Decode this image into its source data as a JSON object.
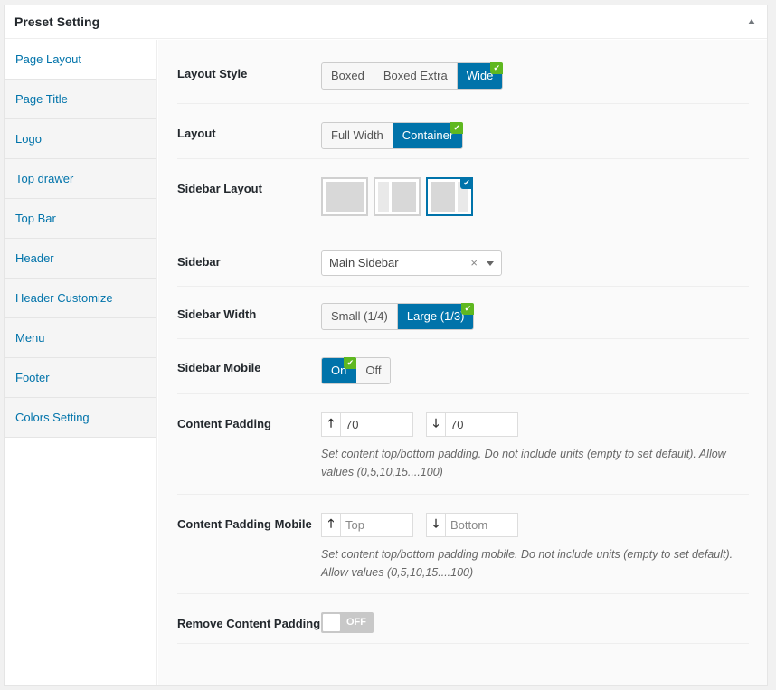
{
  "panel": {
    "title": "Preset Setting"
  },
  "tabs": [
    {
      "label": "Page Layout",
      "active": true
    },
    {
      "label": "Page Title"
    },
    {
      "label": "Logo"
    },
    {
      "label": "Top drawer"
    },
    {
      "label": "Top Bar"
    },
    {
      "label": "Header"
    },
    {
      "label": "Header Customize"
    },
    {
      "label": "Menu"
    },
    {
      "label": "Footer"
    },
    {
      "label": "Colors Setting"
    }
  ],
  "fields": {
    "layout_style": {
      "label": "Layout Style",
      "options": [
        "Boxed",
        "Boxed Extra",
        "Wide"
      ],
      "selected": "Wide"
    },
    "layout": {
      "label": "Layout",
      "options": [
        "Full Width",
        "Container"
      ],
      "selected": "Container"
    },
    "sidebar_layout": {
      "label": "Sidebar Layout",
      "options": [
        "no-sidebar",
        "left-sidebar",
        "right-sidebar"
      ],
      "selected": "right-sidebar"
    },
    "sidebar": {
      "label": "Sidebar",
      "value": "Main Sidebar",
      "clear": "×"
    },
    "sidebar_width": {
      "label": "Sidebar Width",
      "options": [
        "Small (1/4)",
        "Large (1/3)"
      ],
      "selected": "Large (1/3)"
    },
    "sidebar_mobile": {
      "label": "Sidebar Mobile",
      "options": [
        "On",
        "Off"
      ],
      "selected": "On"
    },
    "content_padding": {
      "label": "Content Padding",
      "top_value": "70",
      "bottom_value": "70",
      "description": "Set content top/bottom padding. Do not include units (empty to set default). Allow values (0,5,10,15....100)"
    },
    "content_padding_mobile": {
      "label": "Content Padding Mobile",
      "top_placeholder": "Top",
      "bottom_placeholder": "Bottom",
      "description": "Set content top/bottom padding mobile. Do not include units (empty to set default). Allow values (0,5,10,15....100)"
    },
    "remove_content_padding": {
      "label": "Remove Content Padding",
      "state": "OFF"
    }
  },
  "icons": {
    "up": "arrow-up-icon",
    "down": "arrow-down-icon",
    "check": "check-icon"
  },
  "colors": {
    "accent": "#0073aa",
    "check": "#5fb820",
    "link": "#0073aa"
  }
}
